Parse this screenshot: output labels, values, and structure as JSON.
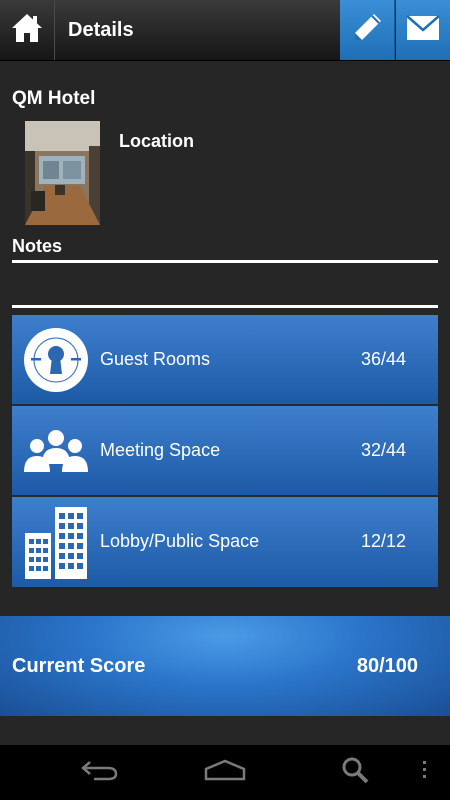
{
  "header": {
    "title": "Details"
  },
  "hotel": {
    "name": "QM Hotel",
    "location_label": "Location",
    "notes_label": "Notes"
  },
  "categories": [
    {
      "label": "Guest Rooms",
      "score": "36/44",
      "icon": "keyhole-icon"
    },
    {
      "label": "Meeting Space",
      "score": "32/44",
      "icon": "people-group-icon"
    },
    {
      "label": "Lobby/Public Space",
      "score": "12/12",
      "icon": "buildings-icon"
    }
  ],
  "current_score": {
    "label": "Current Score",
    "value": "80/100"
  },
  "colors": {
    "accent": "#2a74c9",
    "background": "#262626"
  }
}
